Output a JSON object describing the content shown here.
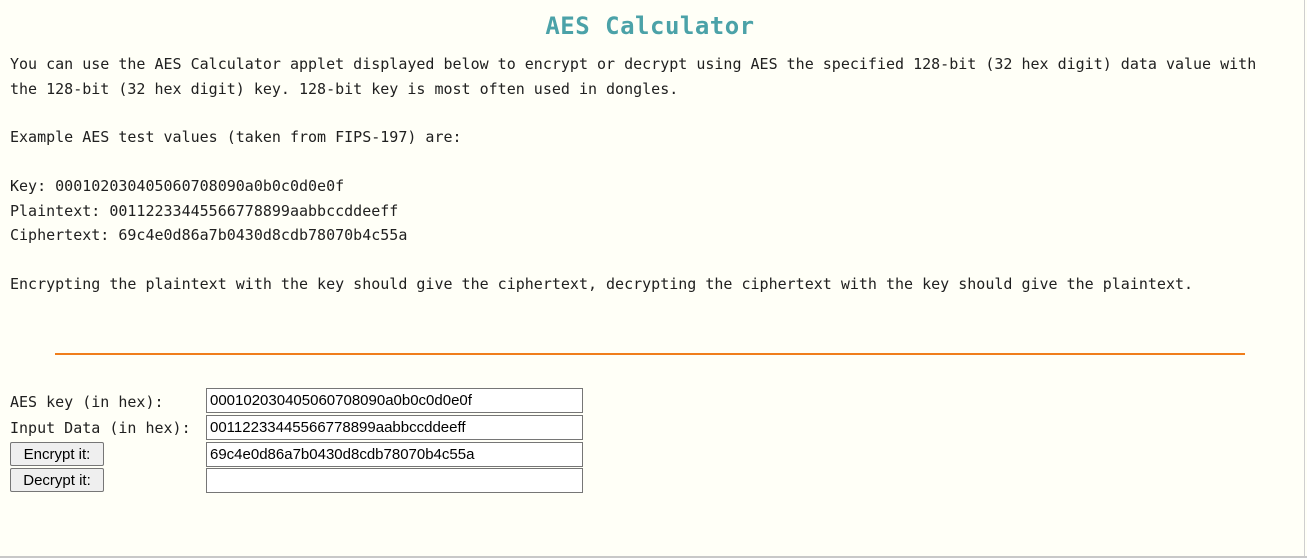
{
  "page": {
    "title": "AES Calculator",
    "intro": "You can use the AES Calculator applet displayed below to encrypt or decrypt using AES the specified 128-bit (32 hex digit) data value with the 128-bit (32 hex digit) key. 128-bit key is most often used in dongles.",
    "example_heading": "Example AES test values (taken from FIPS-197) are:",
    "example": {
      "key_line": "Key: 000102030405060708090a0b0c0d0e0f",
      "plaintext_line": "Plaintext: 00112233445566778899aabbccddeeff",
      "ciphertext_line": "Ciphertext: 69c4e0d86a7b0430d8cdb78070b4c55a"
    },
    "explanation": "Encrypting the plaintext with the key should give the ciphertext, decrypting the ciphertext with the key should give the plaintext."
  },
  "form": {
    "key_label": "AES key (in hex):",
    "key_value": "000102030405060708090a0b0c0d0e0f",
    "input_label": "Input Data (in hex):",
    "input_value": "00112233445566778899aabbccddeeff",
    "encrypt_button": "Encrypt it:",
    "encrypt_result": "69c4e0d86a7b0430d8cdb78070b4c55a",
    "decrypt_button": "Decrypt it:",
    "decrypt_result": ""
  },
  "colors": {
    "title": "#4ba2a8",
    "rule": "#f07e1b",
    "background": "#fffff7"
  }
}
